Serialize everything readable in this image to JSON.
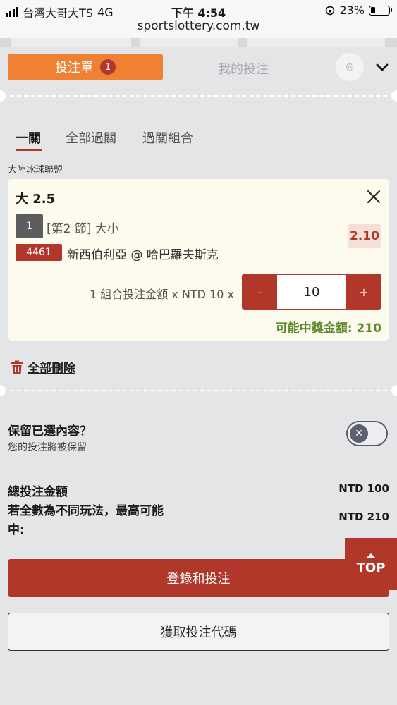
{
  "status_bar": {
    "carrier": "台灣大哥大TS",
    "network": "4G",
    "time": "下午 4:54",
    "url": "sportslottery.com.tw",
    "battery": "23%"
  },
  "tabs": {
    "betslip_label": "投注單",
    "betslip_count": "1",
    "mybets_label": "我的投注"
  },
  "subtabs": [
    "一關",
    "全部過關",
    "過關組合"
  ],
  "league": "大陸冰球聯盟",
  "bet": {
    "title": "大 2.5",
    "period_num": "1",
    "period_text": "[第2 節] 大小",
    "odds": "2.10",
    "match_code": "4461",
    "match_name": "新西伯利亞 @ 哈巴羅夫斯克",
    "stake_label": "1 組合投注金額 x NTD 10 x",
    "minus": "-",
    "plus": "+",
    "stake_value": "10",
    "payout": "可能中獎金額: 210"
  },
  "delete_all": "全部刪除",
  "keep": {
    "title": "保留已選內容？",
    "subtitle": "您的投注將被保留",
    "toggle_state": "off"
  },
  "summary": {
    "total_label": "總投注金額",
    "total_value": "NTD 100",
    "max_label_1": "若全數為不同玩法，最高可能",
    "max_label_2": "中:",
    "max_value": "NTD 210"
  },
  "buttons": {
    "login": "登錄和投注",
    "get_code": "獲取投注代碼",
    "top": "TOP"
  },
  "colors": {
    "accent_orange": "#ef8232",
    "brand_red": "#b2372b",
    "payout_green": "#5d8a2d"
  }
}
